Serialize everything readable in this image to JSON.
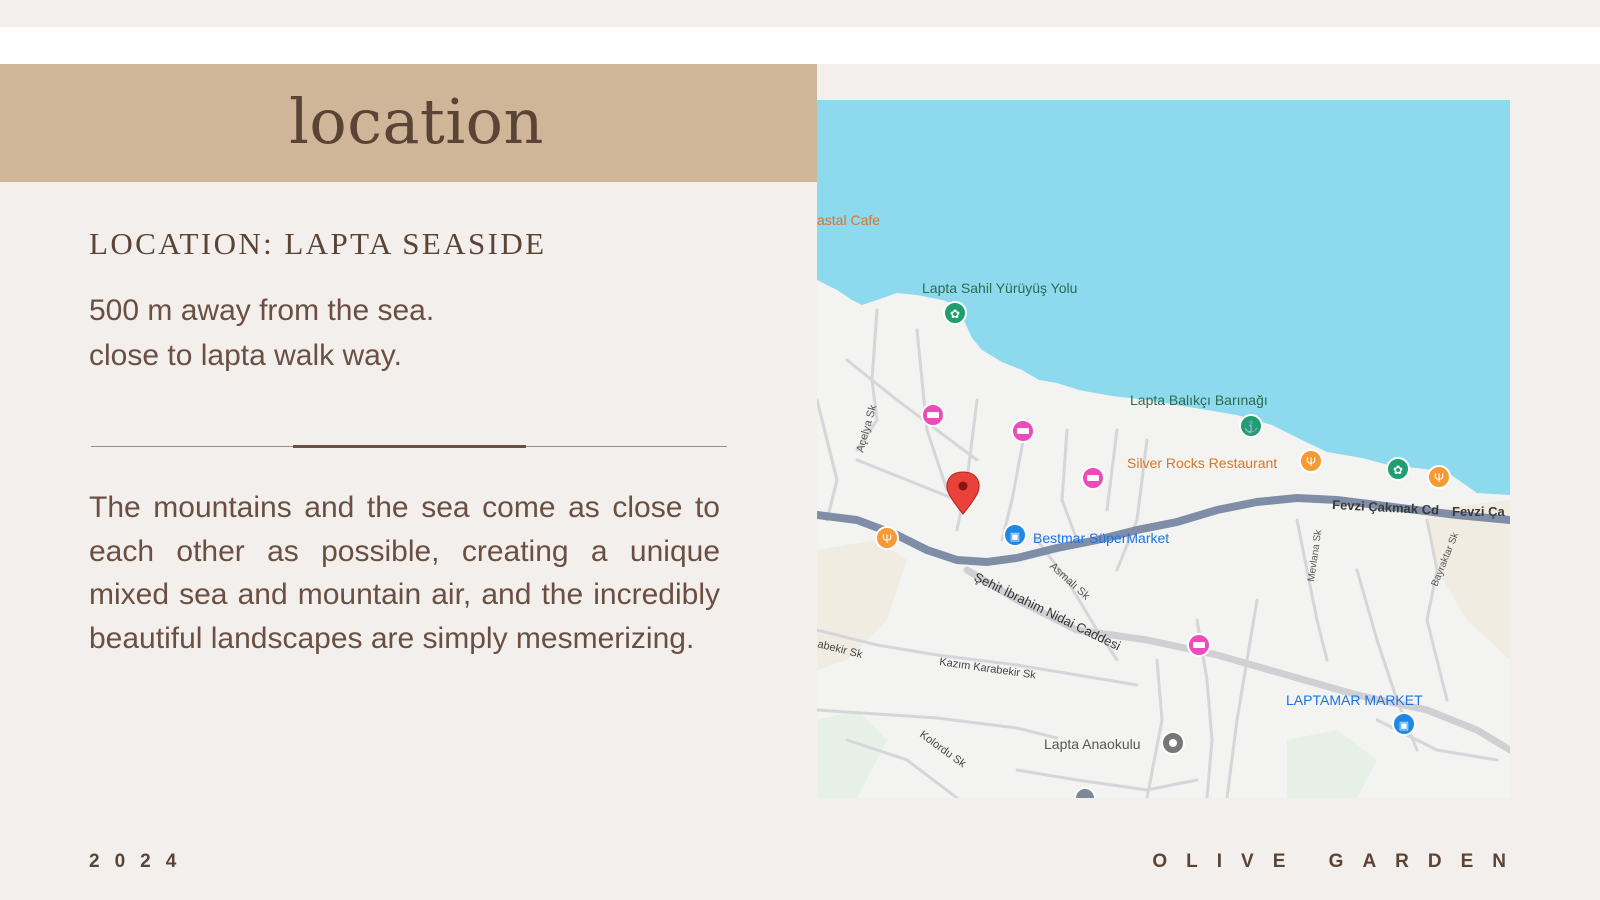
{
  "slide": {
    "title": "location",
    "location_heading": "LOCATION: LAPTA SEASIDE",
    "intro_lines": [
      "500 m away from the sea.",
      "close to lapta walk way."
    ],
    "description": "The mountains and the sea come as close to each other as possible, creating a unique mixed sea and mountain air, and the incredibly beautiful landscapes are simply mesmerizing.",
    "year": "2024",
    "brand": "OLIVE GARDEN"
  },
  "map": {
    "places": {
      "coastal_cafe": "astal Cafe",
      "walkway": "Lapta Sahil Yürüyüş Yolu",
      "harbor": "Lapta Balıkçı Barınağı",
      "silver_rocks": "Silver Rocks Restaurant",
      "bestmar": "Bestmar SüperMarket",
      "laptamar": "LAPTAMAR MARKET",
      "anaokulu": "Lapta Anaokulu"
    },
    "streets": {
      "fevzi": "Fevzi Çakmak Cd",
      "fevzi2": "Fevzi Ça",
      "acelya": "Açelya Sk",
      "asmali": "Asmalı Sk",
      "sehit": "Şehit İbrahim Nidai Caddesi",
      "mevlana": "Mevlana Sk",
      "bayraktar": "Bayraktar Sk",
      "kazim": "Kazım Karabekir Sk",
      "abekir": "abekir Sk",
      "kolordu": "Kolordu Sk"
    },
    "colors": {
      "sea": "#8dd9ee",
      "land": "#f3f3f1",
      "road": "#d9d9db",
      "main_road": "#7f8ea6",
      "hotel": "#ec4bb9",
      "restaurant": "#f59a35",
      "park": "#1f9e70",
      "shop": "#1e88e5",
      "pin": "#e8423a"
    },
    "icons": [
      "location-pin-icon",
      "hotel-icon",
      "restaurant-icon",
      "park-icon",
      "shopping-icon",
      "school-icon"
    ]
  }
}
